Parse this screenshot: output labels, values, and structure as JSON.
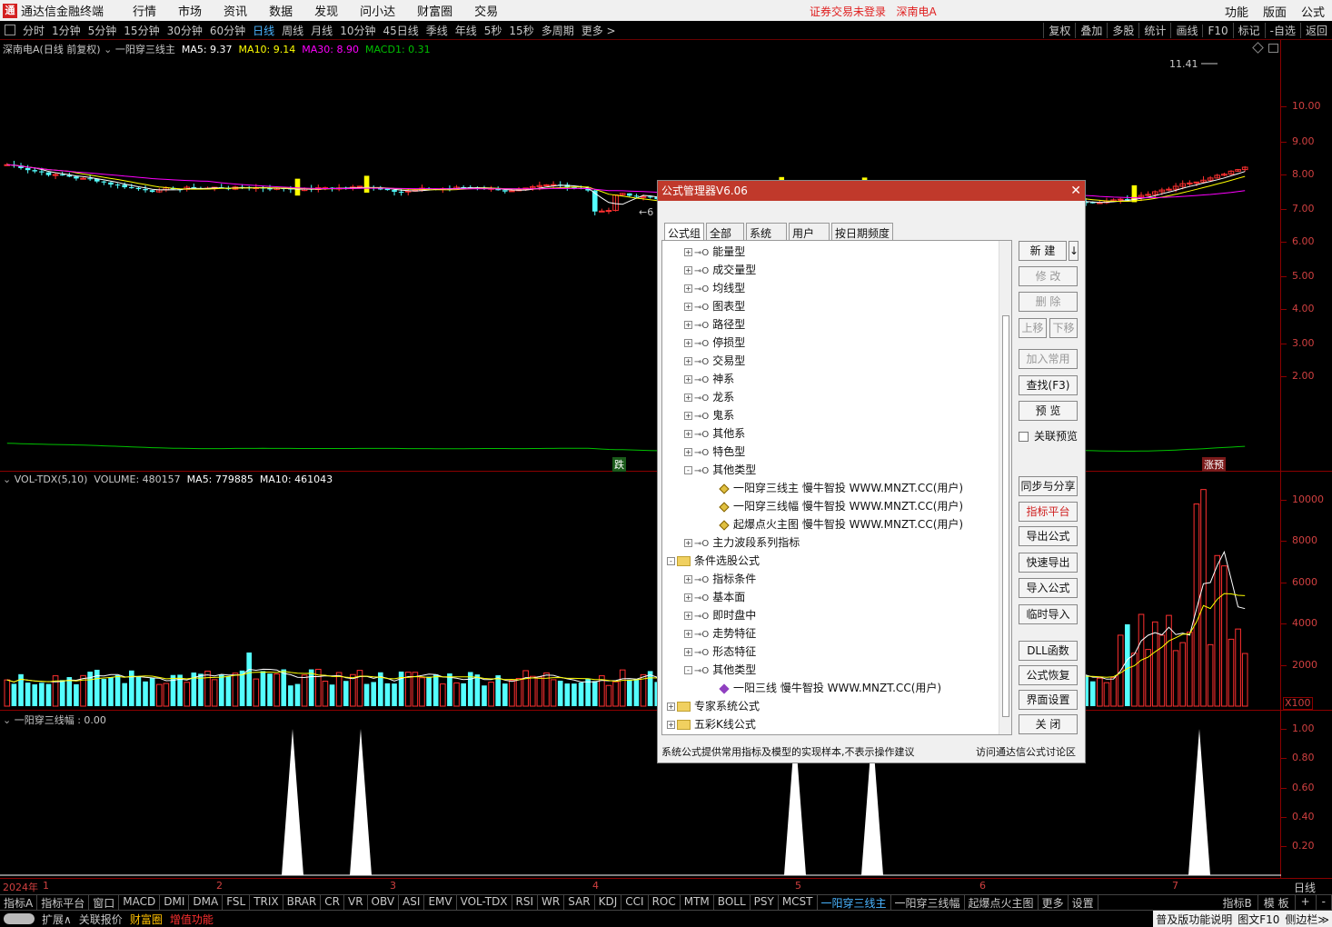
{
  "app": {
    "title": "通达信金融终端",
    "menus": [
      "行情",
      "市场",
      "资讯",
      "数据",
      "发现",
      "问小达",
      "财富圈",
      "交易"
    ],
    "login_status": "证券交易未登录",
    "stock_name": "深南电A",
    "right_menus": [
      "功能",
      "版面",
      "公式"
    ]
  },
  "period_bar": {
    "items": [
      "分时",
      "1分钟",
      "5分钟",
      "15分钟",
      "30分钟",
      "60分钟",
      "日线",
      "周线",
      "月线",
      "10分钟",
      "45日线",
      "季线",
      "年线",
      "5秒",
      "15秒",
      "多周期",
      "更多 >"
    ],
    "active": "日线",
    "right_tools": [
      "复权",
      "叠加",
      "多股",
      "统计",
      "画线",
      "F10",
      "标记",
      "-自选",
      "返回"
    ]
  },
  "main_panel": {
    "title": "深南电A(日线 前复权)",
    "indicator": "一阳穿三线主",
    "ma5": "MA5: 9.37",
    "ma10": "MA10: 9.14",
    "ma30": "MA30: 8.90",
    "macd1": "MACD1: 0.31",
    "high_label": "11.41",
    "low_label": "6",
    "tag_down": "跌",
    "tag_up": "涨预",
    "yticks": [
      "10.00",
      "9.00",
      "8.00",
      "7.00",
      "6.00",
      "5.00",
      "4.00",
      "3.00",
      "2.00"
    ],
    "colors": {
      "up": "#ff3030",
      "down": "#54ffff",
      "ma5": "#ffffff",
      "ma10": "#ffff00",
      "ma30": "#ff00ff",
      "macd": "#00c000",
      "signal": "#ffff00"
    }
  },
  "volume_panel": {
    "title": "VOL-TDX(5,10)",
    "volume": "VOLUME: 480157",
    "ma5": "MA5: 779885",
    "ma10": "MA10: 461043",
    "yticks": [
      "10000",
      "8000",
      "6000",
      "4000",
      "2000"
    ],
    "unit": "X100"
  },
  "signal_panel": {
    "title": "一阳穿三线幅 : 0.00",
    "yticks": [
      "1.00",
      "0.80",
      "0.60",
      "0.40",
      "0.20"
    ]
  },
  "date_axis": {
    "labels": [
      "2024年",
      "1",
      "2",
      "3",
      "4",
      "5",
      "6",
      "7"
    ],
    "period": "日线"
  },
  "indicator_tabs": {
    "items": [
      "指标A",
      "指标平台",
      "窗口",
      "MACD",
      "DMI",
      "DMA",
      "FSL",
      "TRIX",
      "BRAR",
      "CR",
      "VR",
      "OBV",
      "ASI",
      "EMV",
      "VOL-TDX",
      "RSI",
      "WR",
      "SAR",
      "KDJ",
      "CCI",
      "ROC",
      "MTM",
      "BOLL",
      "PSY",
      "MCST",
      "一阳穿三线主",
      "一阳穿三线幅",
      "起爆点火主图",
      "更多",
      "设置"
    ],
    "active": "一阳穿三线主",
    "right": [
      "指标B",
      "模 板",
      "+",
      "-"
    ]
  },
  "status_bar": {
    "items": [
      "扩展∧",
      "关联报价",
      "财富圈",
      "增值功能"
    ],
    "right": [
      "普及版功能说明",
      "图文F10",
      "侧边栏≫"
    ]
  },
  "dialog": {
    "title": "公式管理器V6.06",
    "tabs": [
      "公式组",
      "全部",
      "系统",
      "用户",
      "按日期频度"
    ],
    "tree": [
      {
        "level": 1,
        "type": "key",
        "expand": "+",
        "label": "能量型"
      },
      {
        "level": 1,
        "type": "key",
        "expand": "+",
        "label": "成交量型"
      },
      {
        "level": 1,
        "type": "key",
        "expand": "+",
        "label": "均线型"
      },
      {
        "level": 1,
        "type": "key",
        "expand": "+",
        "label": "图表型"
      },
      {
        "level": 1,
        "type": "key",
        "expand": "+",
        "label": "路径型"
      },
      {
        "level": 1,
        "type": "key",
        "expand": "+",
        "label": "停损型"
      },
      {
        "level": 1,
        "type": "key",
        "expand": "+",
        "label": "交易型"
      },
      {
        "level": 1,
        "type": "key",
        "expand": "+",
        "label": "神系"
      },
      {
        "level": 1,
        "type": "key",
        "expand": "+",
        "label": "龙系"
      },
      {
        "level": 1,
        "type": "key",
        "expand": "+",
        "label": "鬼系"
      },
      {
        "level": 1,
        "type": "key",
        "expand": "+",
        "label": "其他系"
      },
      {
        "level": 1,
        "type": "key",
        "expand": "+",
        "label": "特色型"
      },
      {
        "level": 1,
        "type": "key",
        "expand": "-",
        "label": "其他类型"
      },
      {
        "level": 2,
        "type": "pencil",
        "expand": "",
        "label": "一阳穿三线主   慢牛智投 WWW.MNZT.CC(用户)"
      },
      {
        "level": 2,
        "type": "pencil",
        "expand": "",
        "label": "一阳穿三线幅   慢牛智投 WWW.MNZT.CC(用户)"
      },
      {
        "level": 2,
        "type": "pencil",
        "expand": "",
        "label": "起爆点火主图   慢牛智投 WWW.MNZT.CC(用户)"
      },
      {
        "level": 1,
        "type": "key",
        "expand": "+",
        "label": "主力波段系列指标"
      },
      {
        "level": 0,
        "type": "folder",
        "expand": "-",
        "label": "条件选股公式"
      },
      {
        "level": 1,
        "type": "key",
        "expand": "+",
        "label": "指标条件"
      },
      {
        "level": 1,
        "type": "key",
        "expand": "+",
        "label": "基本面"
      },
      {
        "level": 1,
        "type": "key",
        "expand": "+",
        "label": "即时盘中"
      },
      {
        "level": 1,
        "type": "key",
        "expand": "+",
        "label": "走势特征"
      },
      {
        "level": 1,
        "type": "key",
        "expand": "+",
        "label": "形态特征"
      },
      {
        "level": 1,
        "type": "key",
        "expand": "-",
        "label": "其他类型"
      },
      {
        "level": 2,
        "type": "diamond",
        "expand": "",
        "label": "一阳三线   慢牛智投 WWW.MNZT.CC(用户)"
      },
      {
        "level": 0,
        "type": "folder",
        "expand": "+",
        "label": "专家系统公式"
      },
      {
        "level": 0,
        "type": "folder",
        "expand": "+",
        "label": "五彩K线公式"
      }
    ],
    "buttons": {
      "new": "新 建",
      "new_arrow": "↓",
      "modify": "修 改",
      "delete": "删 除",
      "up": "上移",
      "down": "下移",
      "add_common": "加入常用",
      "find": "查找(F3)",
      "preview": "预 览",
      "sync_share": "同步与分享",
      "indicator_platform": "指标平台",
      "export_formula": "导出公式",
      "quick_export": "快速导出",
      "import_formula": "导入公式",
      "temp_import": "临时导入",
      "dll_func": "DLL函数",
      "restore_formula": "公式恢复",
      "ui_settings": "界面设置",
      "close": "关 闭"
    },
    "checkbox_label": "关联预览",
    "footnote": "系统公式提供常用指标及模型的实现样本,不表示操作建议",
    "footlink": "访问通达信公式讨论区"
  }
}
